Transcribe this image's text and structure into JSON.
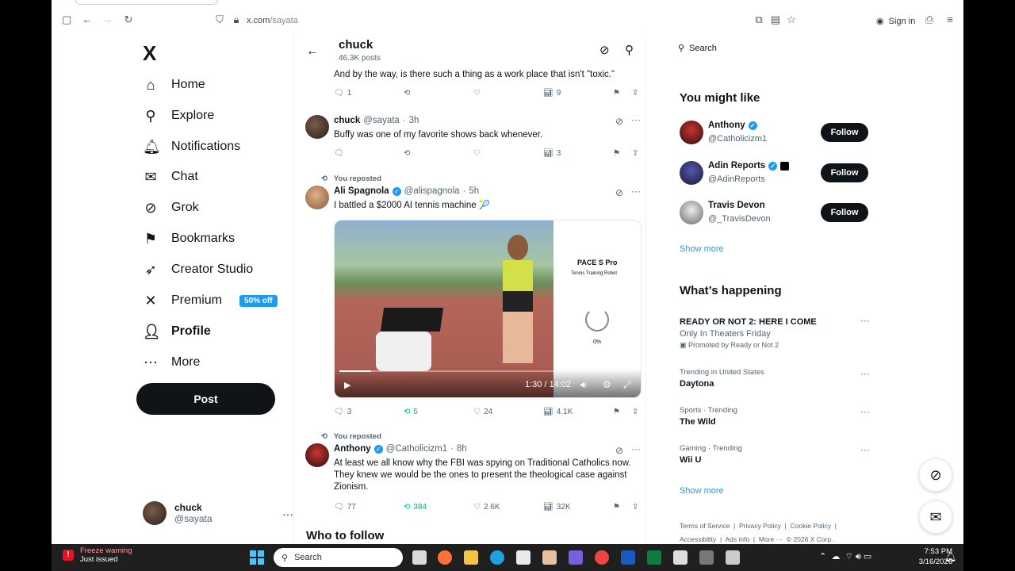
{
  "browser": {
    "url_host": "x.com",
    "url_path": "/sayata",
    "sign_in": "Sign in"
  },
  "nav": {
    "logo": "X",
    "items": [
      {
        "label": "Home",
        "icon": "home-icon"
      },
      {
        "label": "Explore",
        "icon": "search-icon"
      },
      {
        "label": "Notifications",
        "icon": "bell-icon"
      },
      {
        "label": "Chat",
        "icon": "mail-icon"
      },
      {
        "label": "Grok",
        "icon": "grok-icon"
      },
      {
        "label": "Bookmarks",
        "icon": "bookmark-icon"
      },
      {
        "label": "Creator Studio",
        "icon": "rocket-icon"
      },
      {
        "label": "Premium",
        "icon": "x-icon"
      },
      {
        "label": "Profile",
        "icon": "person-icon"
      },
      {
        "label": "More",
        "icon": "more-circle-icon"
      }
    ],
    "premium_badge": "50% off",
    "post_label": "Post",
    "account": {
      "name": "chuck",
      "handle": "@sayata"
    }
  },
  "profile_header": {
    "title": "chuck",
    "post_count": "46.3K posts"
  },
  "tweets": [
    {
      "text": "And by the way, is there such a thing as a work place that isn't \"toxic.\"",
      "replies": "1",
      "reposts": "",
      "likes": "",
      "views": "9"
    },
    {
      "name": "chuck",
      "handle": "@sayata",
      "time": "3h",
      "text": "Buffy was one of my favorite shows back whenever.",
      "replies": "",
      "reposts": "",
      "likes": "",
      "views": "3"
    },
    {
      "repost_label": "You reposted",
      "name": "Ali Spagnola",
      "handle": "@alispagnola",
      "time": "5h",
      "text": "I battled a $2000 AI tennis machine 🎾",
      "media": {
        "panel_title": "PACE S Pro",
        "panel_subtitle": "Tennis Training Robot",
        "panel_progress": "0%",
        "time": "1:30 / 14:02",
        "played_fraction": 0.107
      },
      "replies": "3",
      "reposts": "5",
      "likes": "24",
      "views": "4.1K"
    },
    {
      "repost_label": "You reposted",
      "name": "Anthony",
      "handle": "@Catholicizm1",
      "time": "8h",
      "text": "At least we all know why the FBI was spying on Traditional Catholics now. They knew we would be the ones to present the theological case against Zionism.",
      "replies": "77",
      "reposts": "384",
      "likes": "2.6K",
      "views": "32K"
    }
  ],
  "who_to_follow": "Who to follow",
  "right": {
    "search_placeholder": "Search",
    "might_like_title": "You might like",
    "suggestions": [
      {
        "name": "Anthony",
        "handle": "@Catholicizm1"
      },
      {
        "name": "Adin Reports",
        "handle": "@AdinReports"
      },
      {
        "name": "Travis Devon",
        "handle": "@_TravisDevon"
      }
    ],
    "follow_label": "Follow",
    "show_more": "Show more",
    "happening_title": "What’s happening",
    "trends": [
      {
        "context": "",
        "title": "READY OR NOT 2: HERE I COME",
        "subtitle": "Only In Theaters Friday",
        "promo": "Promoted by Ready or Not 2"
      },
      {
        "context": "Trending in United States",
        "title": "Daytona"
      },
      {
        "context": "Sports · Trending",
        "title": "The Wild"
      },
      {
        "context": "Gaming · Trending",
        "title": "Wii U"
      }
    ],
    "footer": [
      "Terms of Service",
      "Privacy Policy",
      "Cookie Policy",
      "Accessibility",
      "Ads info",
      "More ···",
      "© 2026 X Corp."
    ]
  },
  "taskbar": {
    "warning_title": "Freeze warning",
    "warning_sub": "Just issued",
    "search": "Search",
    "time": "7:53 PM",
    "date": "3/16/2026"
  },
  "colors": {
    "accent": "#1d9bf0",
    "repost_green": "#00ba7c",
    "text": "#0f1419",
    "muted": "#536471"
  }
}
